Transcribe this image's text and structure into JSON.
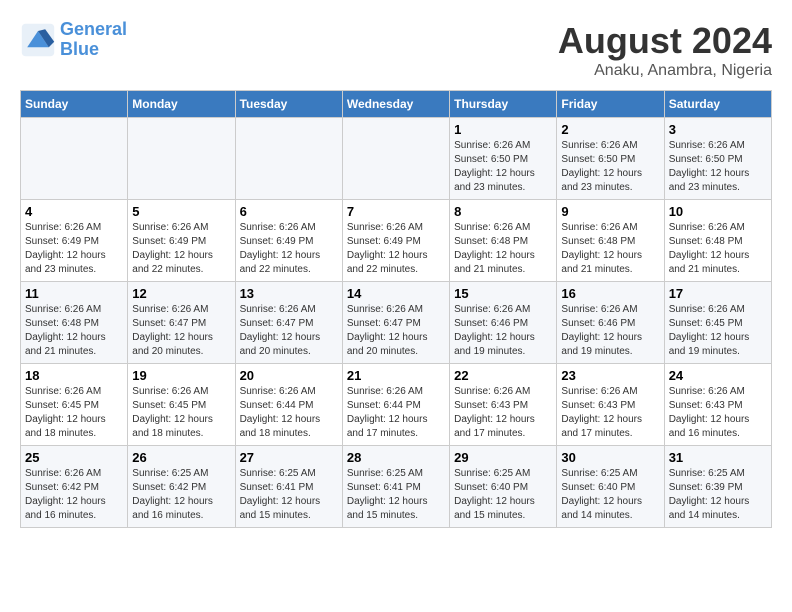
{
  "header": {
    "logo_line1": "General",
    "logo_line2": "Blue",
    "title": "August 2024",
    "subtitle": "Anaku, Anambra, Nigeria"
  },
  "days_of_week": [
    "Sunday",
    "Monday",
    "Tuesday",
    "Wednesday",
    "Thursday",
    "Friday",
    "Saturday"
  ],
  "weeks": [
    {
      "cells": [
        {
          "day": "",
          "info": ""
        },
        {
          "day": "",
          "info": ""
        },
        {
          "day": "",
          "info": ""
        },
        {
          "day": "",
          "info": ""
        },
        {
          "day": "1",
          "info": "Sunrise: 6:26 AM\nSunset: 6:50 PM\nDaylight: 12 hours\nand 23 minutes."
        },
        {
          "day": "2",
          "info": "Sunrise: 6:26 AM\nSunset: 6:50 PM\nDaylight: 12 hours\nand 23 minutes."
        },
        {
          "day": "3",
          "info": "Sunrise: 6:26 AM\nSunset: 6:50 PM\nDaylight: 12 hours\nand 23 minutes."
        }
      ]
    },
    {
      "cells": [
        {
          "day": "4",
          "info": "Sunrise: 6:26 AM\nSunset: 6:49 PM\nDaylight: 12 hours\nand 23 minutes."
        },
        {
          "day": "5",
          "info": "Sunrise: 6:26 AM\nSunset: 6:49 PM\nDaylight: 12 hours\nand 22 minutes."
        },
        {
          "day": "6",
          "info": "Sunrise: 6:26 AM\nSunset: 6:49 PM\nDaylight: 12 hours\nand 22 minutes."
        },
        {
          "day": "7",
          "info": "Sunrise: 6:26 AM\nSunset: 6:49 PM\nDaylight: 12 hours\nand 22 minutes."
        },
        {
          "day": "8",
          "info": "Sunrise: 6:26 AM\nSunset: 6:48 PM\nDaylight: 12 hours\nand 21 minutes."
        },
        {
          "day": "9",
          "info": "Sunrise: 6:26 AM\nSunset: 6:48 PM\nDaylight: 12 hours\nand 21 minutes."
        },
        {
          "day": "10",
          "info": "Sunrise: 6:26 AM\nSunset: 6:48 PM\nDaylight: 12 hours\nand 21 minutes."
        }
      ]
    },
    {
      "cells": [
        {
          "day": "11",
          "info": "Sunrise: 6:26 AM\nSunset: 6:48 PM\nDaylight: 12 hours\nand 21 minutes."
        },
        {
          "day": "12",
          "info": "Sunrise: 6:26 AM\nSunset: 6:47 PM\nDaylight: 12 hours\nand 20 minutes."
        },
        {
          "day": "13",
          "info": "Sunrise: 6:26 AM\nSunset: 6:47 PM\nDaylight: 12 hours\nand 20 minutes."
        },
        {
          "day": "14",
          "info": "Sunrise: 6:26 AM\nSunset: 6:47 PM\nDaylight: 12 hours\nand 20 minutes."
        },
        {
          "day": "15",
          "info": "Sunrise: 6:26 AM\nSunset: 6:46 PM\nDaylight: 12 hours\nand 19 minutes."
        },
        {
          "day": "16",
          "info": "Sunrise: 6:26 AM\nSunset: 6:46 PM\nDaylight: 12 hours\nand 19 minutes."
        },
        {
          "day": "17",
          "info": "Sunrise: 6:26 AM\nSunset: 6:45 PM\nDaylight: 12 hours\nand 19 minutes."
        }
      ]
    },
    {
      "cells": [
        {
          "day": "18",
          "info": "Sunrise: 6:26 AM\nSunset: 6:45 PM\nDaylight: 12 hours\nand 18 minutes."
        },
        {
          "day": "19",
          "info": "Sunrise: 6:26 AM\nSunset: 6:45 PM\nDaylight: 12 hours\nand 18 minutes."
        },
        {
          "day": "20",
          "info": "Sunrise: 6:26 AM\nSunset: 6:44 PM\nDaylight: 12 hours\nand 18 minutes."
        },
        {
          "day": "21",
          "info": "Sunrise: 6:26 AM\nSunset: 6:44 PM\nDaylight: 12 hours\nand 17 minutes."
        },
        {
          "day": "22",
          "info": "Sunrise: 6:26 AM\nSunset: 6:43 PM\nDaylight: 12 hours\nand 17 minutes."
        },
        {
          "day": "23",
          "info": "Sunrise: 6:26 AM\nSunset: 6:43 PM\nDaylight: 12 hours\nand 17 minutes."
        },
        {
          "day": "24",
          "info": "Sunrise: 6:26 AM\nSunset: 6:43 PM\nDaylight: 12 hours\nand 16 minutes."
        }
      ]
    },
    {
      "cells": [
        {
          "day": "25",
          "info": "Sunrise: 6:26 AM\nSunset: 6:42 PM\nDaylight: 12 hours\nand 16 minutes."
        },
        {
          "day": "26",
          "info": "Sunrise: 6:25 AM\nSunset: 6:42 PM\nDaylight: 12 hours\nand 16 minutes."
        },
        {
          "day": "27",
          "info": "Sunrise: 6:25 AM\nSunset: 6:41 PM\nDaylight: 12 hours\nand 15 minutes."
        },
        {
          "day": "28",
          "info": "Sunrise: 6:25 AM\nSunset: 6:41 PM\nDaylight: 12 hours\nand 15 minutes."
        },
        {
          "day": "29",
          "info": "Sunrise: 6:25 AM\nSunset: 6:40 PM\nDaylight: 12 hours\nand 15 minutes."
        },
        {
          "day": "30",
          "info": "Sunrise: 6:25 AM\nSunset: 6:40 PM\nDaylight: 12 hours\nand 14 minutes."
        },
        {
          "day": "31",
          "info": "Sunrise: 6:25 AM\nSunset: 6:39 PM\nDaylight: 12 hours\nand 14 minutes."
        }
      ]
    }
  ]
}
